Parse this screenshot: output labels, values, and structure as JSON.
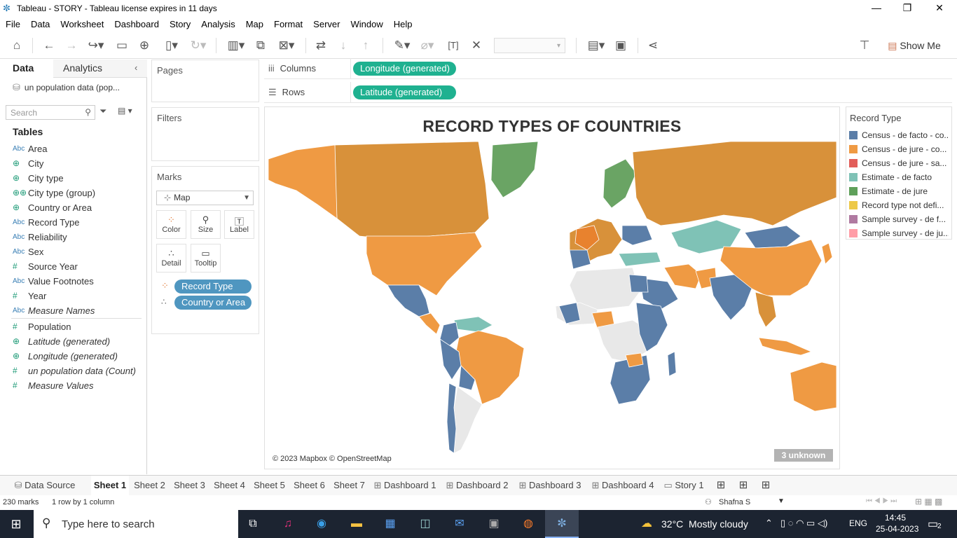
{
  "window": {
    "title": "Tableau - STORY - Tableau license expires in 11 days",
    "minimize": "—",
    "restore": "❐",
    "close": "✕"
  },
  "menu": [
    "File",
    "Data",
    "Worksheet",
    "Dashboard",
    "Story",
    "Analysis",
    "Map",
    "Format",
    "Server",
    "Window",
    "Help"
  ],
  "toolbar": {
    "show_me": "Show Me"
  },
  "left_panel": {
    "tab_data": "Data",
    "tab_analytics": "Analytics",
    "datasource": "un population data (pop...",
    "search_placeholder": "Search",
    "tables_header": "Tables",
    "fields": [
      {
        "icon": "Abc",
        "name": "Area"
      },
      {
        "icon": "globe",
        "name": "City"
      },
      {
        "icon": "globe",
        "name": "City type"
      },
      {
        "icon": "group",
        "name": "City type (group)"
      },
      {
        "icon": "globe",
        "name": "Country or Area"
      },
      {
        "icon": "Abc",
        "name": "Record Type"
      },
      {
        "icon": "Abc",
        "name": "Reliability"
      },
      {
        "icon": "Abc",
        "name": "Sex"
      },
      {
        "icon": "#",
        "name": "Source Year"
      },
      {
        "icon": "Abc",
        "name": "Value Footnotes"
      },
      {
        "icon": "#",
        "name": "Year"
      },
      {
        "icon": "Abc",
        "name": "Measure Names"
      }
    ],
    "measures": [
      {
        "icon": "#",
        "name": "Population"
      },
      {
        "icon": "globe",
        "name": "Latitude (generated)"
      },
      {
        "icon": "globe",
        "name": "Longitude (generated)"
      },
      {
        "icon": "#",
        "name": "un population data (Count)"
      },
      {
        "icon": "#",
        "name": "Measure Values"
      }
    ]
  },
  "cards": {
    "pages": "Pages",
    "filters": "Filters",
    "marks": "Marks",
    "mark_type": "Map",
    "buttons": [
      "Color",
      "Size",
      "Label",
      "Detail",
      "Tooltip"
    ],
    "mark_pills": [
      "Record Type",
      "Country or Area"
    ]
  },
  "shelves": {
    "columns_label": "Columns",
    "columns_pill": "Longitude (generated)",
    "rows_label": "Rows",
    "rows_pill": "Latitude (generated)"
  },
  "view": {
    "title": "RECORD TYPES OF COUNTRIES",
    "copyright": "© 2023 Mapbox © OpenStreetMap",
    "unknown_badge": "3 unknown"
  },
  "legend": {
    "title": "Record Type",
    "items": [
      {
        "label": "Census - de facto - co...",
        "color": "#5b7ea8"
      },
      {
        "label": "Census - de jure - co...",
        "color": "#ef9a43"
      },
      {
        "label": "Census - de jure - sa...",
        "color": "#e25e5a"
      },
      {
        "label": "Estimate - de facto",
        "color": "#7fc2b6"
      },
      {
        "label": "Estimate - de jure",
        "color": "#5fa05a"
      },
      {
        "label": "Record type not defi...",
        "color": "#edc948"
      },
      {
        "label": "Sample survey - de f...",
        "color": "#b07aa1"
      },
      {
        "label": "Sample survey - de ju...",
        "color": "#ff9da7"
      }
    ]
  },
  "sheet_tabs": [
    "Data Source",
    "Sheet 1",
    "Sheet 2",
    "Sheet 3",
    "Sheet 4",
    "Sheet 5",
    "Sheet 6",
    "Sheet 7",
    "Dashboard 1",
    "Dashboard 2",
    "Dashboard 3",
    "Dashboard 4",
    "Story 1"
  ],
  "status": {
    "marks": "230 marks",
    "layout": "1 row by 1 column",
    "user": "Shafna S"
  },
  "taskbar": {
    "search_placeholder": "Type here to search",
    "weather": "32°C  Mostly cloudy",
    "lang": "ENG",
    "time": "14:45",
    "date": "25-04-2023",
    "notif_count": "2"
  }
}
